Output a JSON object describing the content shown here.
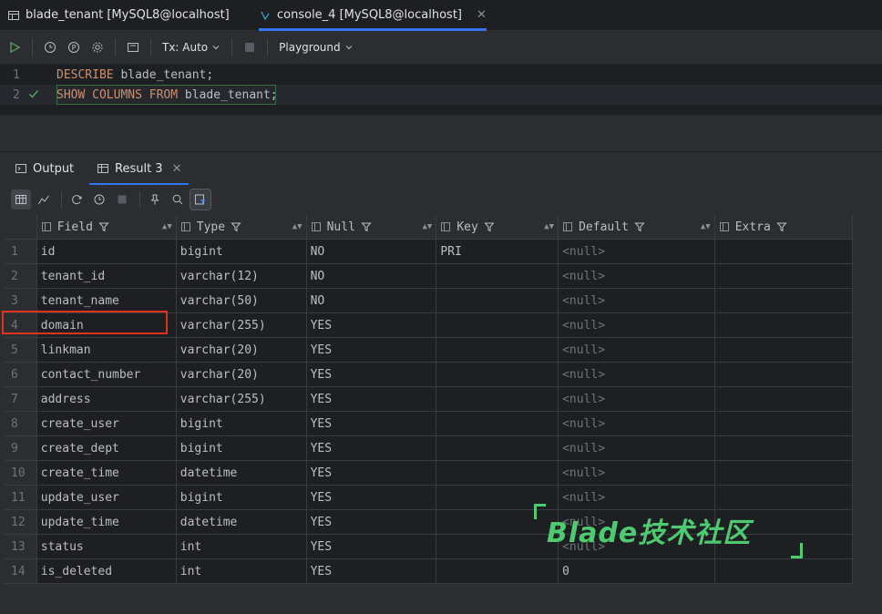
{
  "editor_tabs": [
    {
      "label": "blade_tenant [MySQL8@localhost]"
    },
    {
      "label": "console_4 [MySQL8@localhost]"
    }
  ],
  "toolbar": {
    "tx_label": "Tx: Auto",
    "playground_label": "Playground"
  },
  "editor": {
    "lines": [
      {
        "num": "1",
        "kw": "DESCRIBE",
        "rest": " blade_tenant;"
      },
      {
        "num": "2",
        "kw": "SHOW COLUMNS FROM",
        "rest": " blade_tenant;"
      }
    ]
  },
  "result_tabs": {
    "output": "Output",
    "result": "Result 3"
  },
  "table": {
    "columns": [
      "Field",
      "Type",
      "Null",
      "Key",
      "Default",
      "Extra"
    ],
    "rows": [
      [
        "1",
        "id",
        "bigint",
        "NO",
        "PRI",
        "<null>",
        ""
      ],
      [
        "2",
        "tenant_id",
        "varchar(12)",
        "NO",
        "",
        "<null>",
        ""
      ],
      [
        "3",
        "tenant_name",
        "varchar(50)",
        "NO",
        "",
        "<null>",
        ""
      ],
      [
        "4",
        "domain",
        "varchar(255)",
        "YES",
        "",
        "<null>",
        ""
      ],
      [
        "5",
        "linkman",
        "varchar(20)",
        "YES",
        "",
        "<null>",
        ""
      ],
      [
        "6",
        "contact_number",
        "varchar(20)",
        "YES",
        "",
        "<null>",
        ""
      ],
      [
        "7",
        "address",
        "varchar(255)",
        "YES",
        "",
        "<null>",
        ""
      ],
      [
        "8",
        "create_user",
        "bigint",
        "YES",
        "",
        "<null>",
        ""
      ],
      [
        "9",
        "create_dept",
        "bigint",
        "YES",
        "",
        "<null>",
        ""
      ],
      [
        "10",
        "create_time",
        "datetime",
        "YES",
        "",
        "<null>",
        ""
      ],
      [
        "11",
        "update_user",
        "bigint",
        "YES",
        "",
        "<null>",
        ""
      ],
      [
        "12",
        "update_time",
        "datetime",
        "YES",
        "",
        "<null>",
        ""
      ],
      [
        "13",
        "status",
        "int",
        "YES",
        "",
        "<null>",
        ""
      ],
      [
        "14",
        "is_deleted",
        "int",
        "YES",
        "",
        "0",
        ""
      ]
    ]
  },
  "watermark": "Blade技术社区",
  "colors": {
    "accent": "#3574f0",
    "keyword": "#cf8e6d",
    "highlight": "#e0311c",
    "watermark": "#4ecb71",
    "run": "#57965c"
  }
}
